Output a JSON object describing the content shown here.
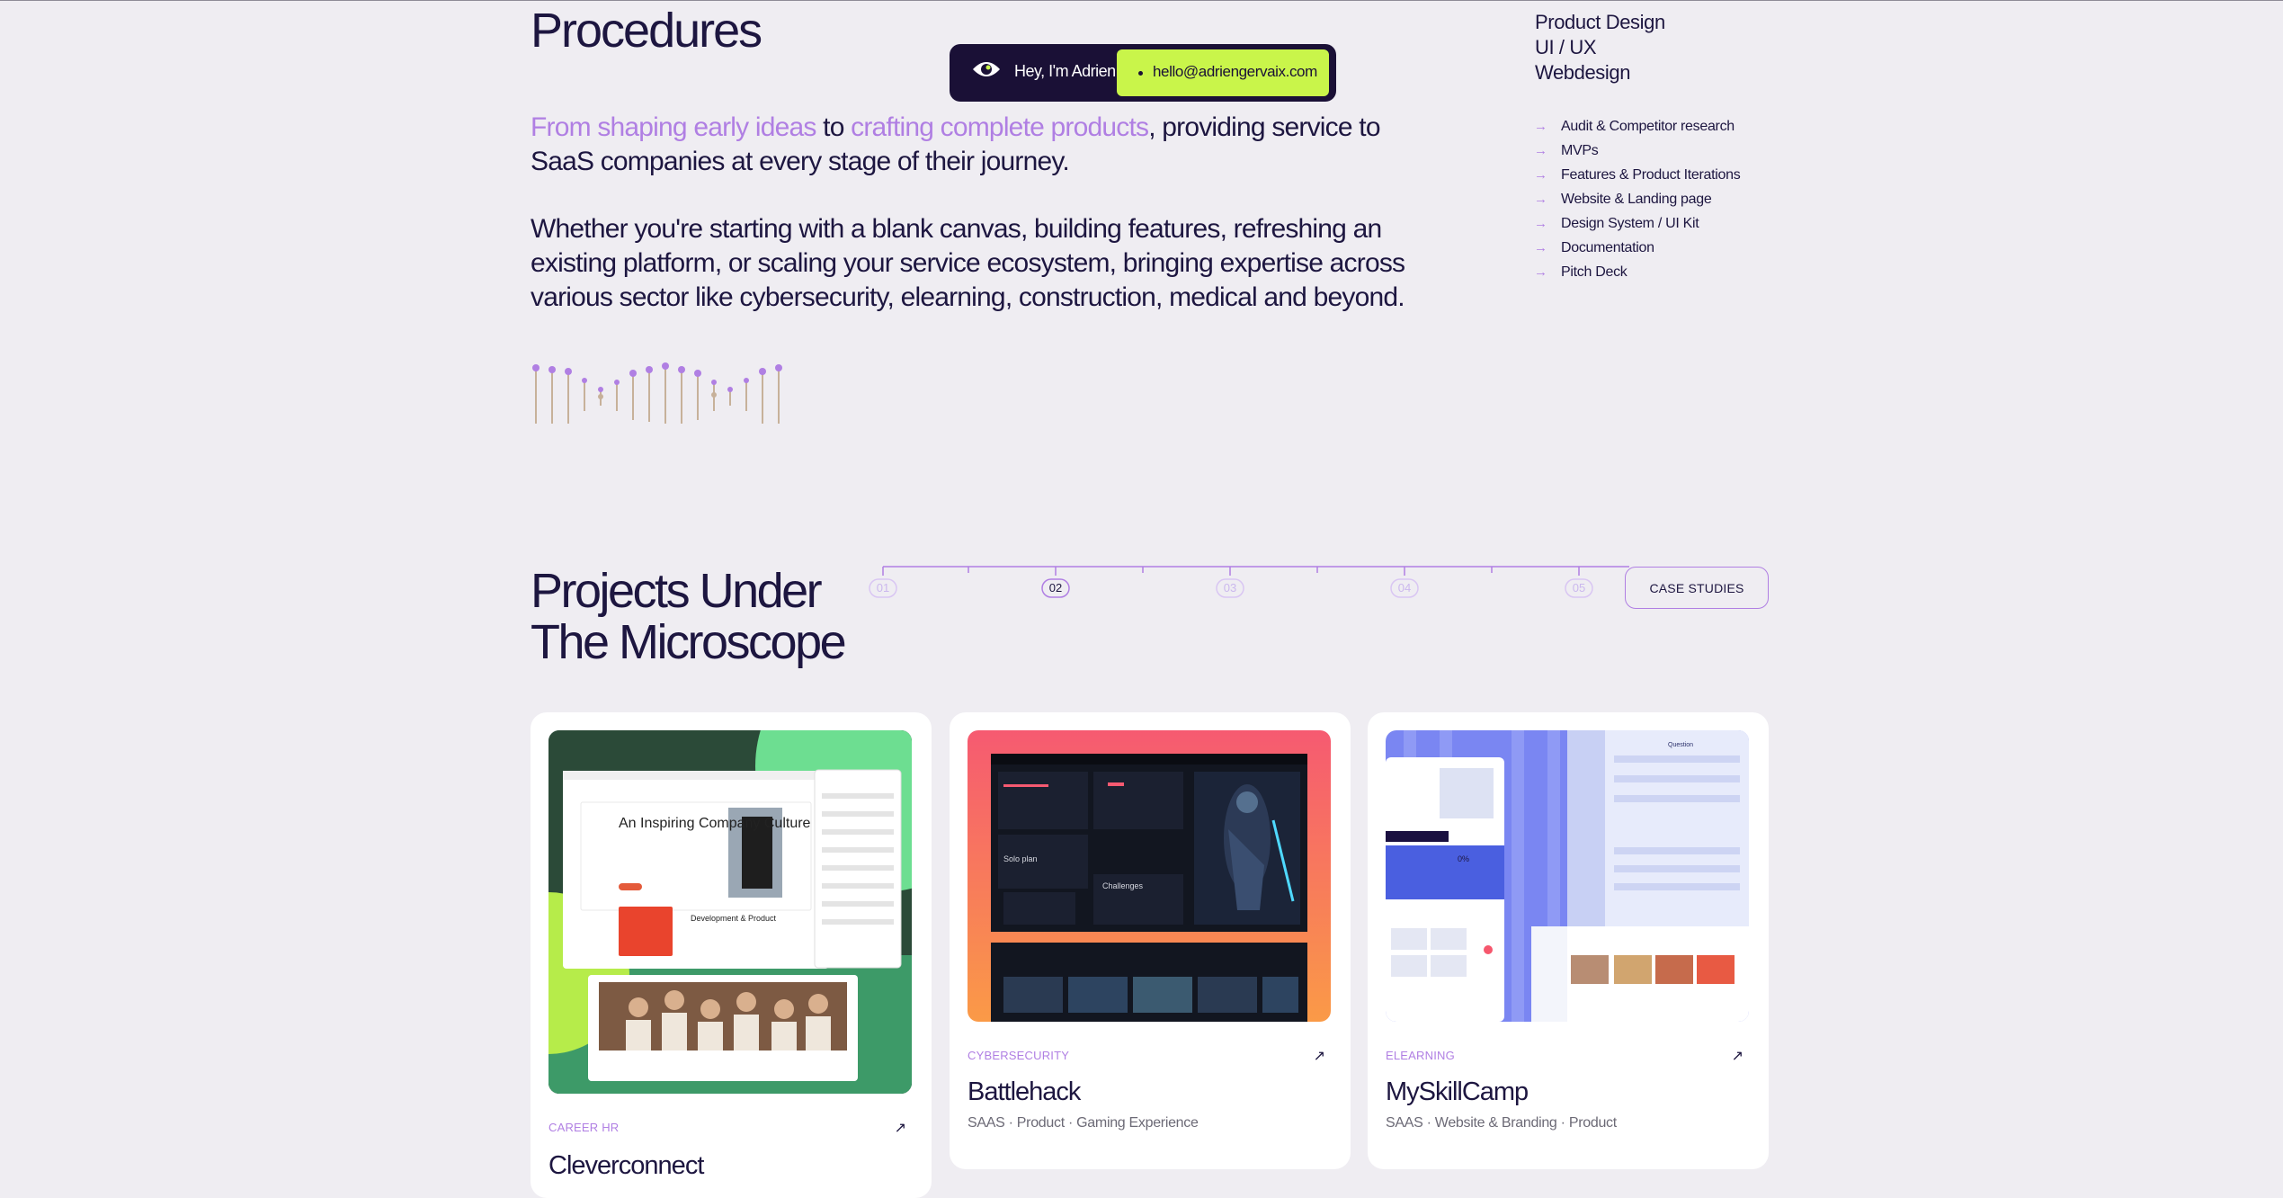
{
  "procedures": {
    "title": "Procedures",
    "intro_highlight_1": "From shaping early ideas",
    "intro_mid": " to ",
    "intro_highlight_2": "crafting complete products",
    "intro_rest": ", providing service to SaaS companies at every stage of their journey.",
    "paragraph": "Whether you're starting with a blank canvas, building features, refreshing an existing platform, or scaling your service ecosystem, bringing expertise across various sector like cybersecurity, elearning, construction, medical and beyond."
  },
  "hello_pill": {
    "greeting": "Hey, I'm Adrien",
    "email": "hello@adriengervaix.com",
    "icon": "eye-icon"
  },
  "services": {
    "titles": [
      "Product Design",
      "UI / UX",
      "Webdesign"
    ],
    "items": [
      "Audit & Competitor research",
      "MVPs",
      "Features & Product Iterations",
      "Website & Landing page",
      "Design System / UI Kit",
      "Documentation",
      "Pitch Deck"
    ],
    "arrow_glyph": "→"
  },
  "projects": {
    "title_line1": "Projects Under",
    "title_line2": "The Microscope",
    "steps": [
      "01",
      "02",
      "03",
      "04",
      "05"
    ],
    "active_step": "02",
    "case_studies_label": "CASE STUDIES",
    "cards": [
      {
        "category": "CAREER HR",
        "name": "Cleverconnect",
        "meta": "",
        "thumb_headline": "An Inspiring Company Culture",
        "thumb_sub": "Development & Product"
      },
      {
        "category": "CYBERSECURITY",
        "name": "Battlehack",
        "meta": "SAAS · Product · Gaming Experience",
        "thumb_label_1": "Solo plan",
        "thumb_label_2": "Challenges"
      },
      {
        "category": "ELEARNING",
        "name": "MySkillCamp",
        "meta": "SAAS · Website & Branding · Product",
        "thumb_label_1": "Question",
        "thumb_label_2": "0%"
      }
    ],
    "link_glyph": "↗"
  },
  "colors": {
    "background": "#efedf2",
    "ink": "#1d1640",
    "accent": "#b07fe3",
    "lime": "#c9f54a"
  }
}
